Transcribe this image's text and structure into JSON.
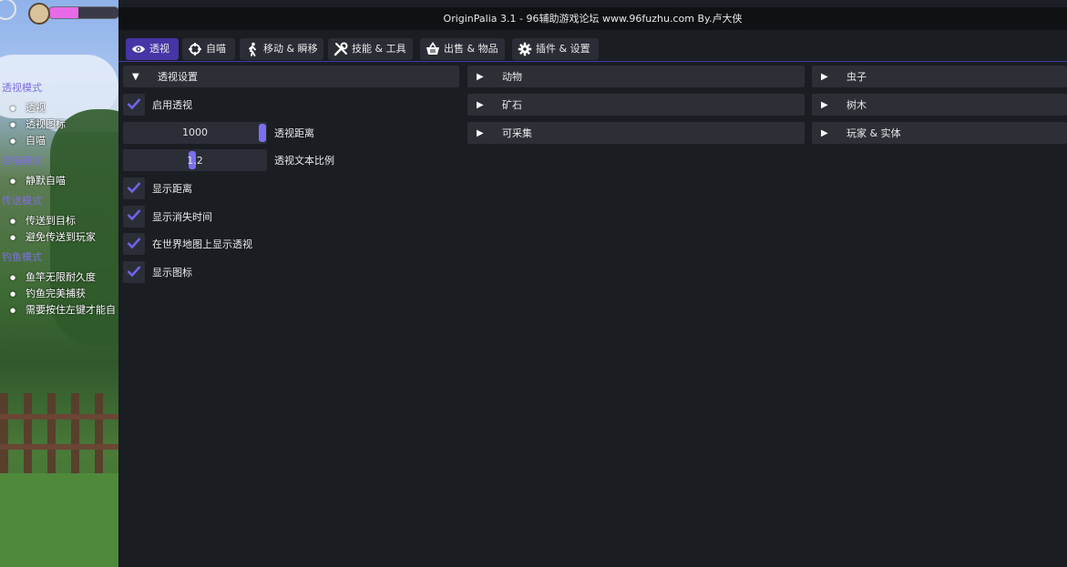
{
  "window": {
    "title": "OriginPalia 3.1 - 96辅助游戏论坛 www.96fuzhu.com By.卢大侠"
  },
  "hud": {
    "progress": 0.42,
    "bar_color": "#e86ae8"
  },
  "overlay": {
    "categories": [
      {
        "title": "透视模式",
        "items": [
          "透视",
          "透视图标",
          "自喵"
        ]
      },
      {
        "title": "自喵模式",
        "items": [
          "静默自喵"
        ]
      },
      {
        "title": "传送模式",
        "items": [
          "传送到目标",
          "避免传送到玩家"
        ]
      },
      {
        "title": "钓鱼模式",
        "items": [
          "鱼竿无限耐久度",
          "钓鱼完美捕获",
          "需要按住左键才能自"
        ]
      }
    ]
  },
  "tabs": [
    {
      "label": "透视",
      "icon": "eye-icon",
      "active": true
    },
    {
      "label": "自喵",
      "icon": "crosshair-icon",
      "active": false
    },
    {
      "label": "移动 & 瞬移",
      "icon": "walking-icon",
      "active": false
    },
    {
      "label": "技能 & 工具",
      "icon": "tools-icon",
      "active": false
    },
    {
      "label": "出售 & 物品",
      "icon": "basket-icon",
      "active": false
    },
    {
      "label": "插件 & 设置",
      "icon": "gear-icon",
      "active": false
    }
  ],
  "esp_settings": {
    "header": "透视设置",
    "expanded_arrow": "▼",
    "enable_esp": {
      "label": "启用透视",
      "checked": true
    },
    "distance": {
      "label": "透视距离",
      "value": "1000",
      "fraction": 1.0
    },
    "text_scale": {
      "label": "透视文本比例",
      "value": "1.2",
      "fraction": 0.48
    },
    "show_distance": {
      "label": "显示距离",
      "checked": true
    },
    "show_despawn": {
      "label": "显示消失时间",
      "checked": true
    },
    "show_on_map": {
      "label": "在世界地图上显示透视",
      "checked": true
    },
    "show_icons": {
      "label": "显示图标",
      "checked": true
    }
  },
  "column2": {
    "collapsed_arrow": "▶",
    "headers": [
      "动物",
      "矿石",
      "可采集"
    ]
  },
  "column3": {
    "collapsed_arrow": "▶",
    "headers": [
      "虫子",
      "树木",
      "玩家 & 实体"
    ]
  },
  "colors": {
    "accent": "#4535a6",
    "check": "#6f63e8",
    "panel": "#2c2f36",
    "background": "#1a1d22"
  }
}
